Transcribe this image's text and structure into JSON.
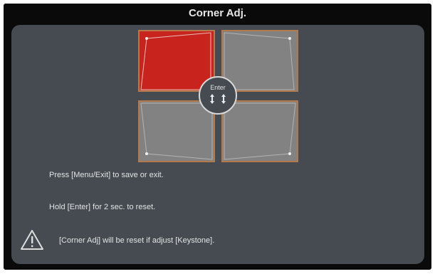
{
  "title": "Corner Adj.",
  "enter_button": {
    "label": "Enter"
  },
  "messages": {
    "line1": "Press [Menu/Exit] to save or exit.",
    "line2": "Hold [Enter] for 2 sec. to reset.",
    "warning": "[Corner Adj] will be reset if adjust [Keystone]."
  },
  "quadrants": {
    "selected": "top-left"
  },
  "colors": {
    "selected_quadrant": "#c8231d",
    "quadrant": "#828282",
    "quadrant_border": "#b57a4c",
    "panel": "#454b50"
  },
  "icons": {
    "warning": "warning-triangle-icon",
    "enter_arrows": "four-direction-arrows-icon"
  }
}
